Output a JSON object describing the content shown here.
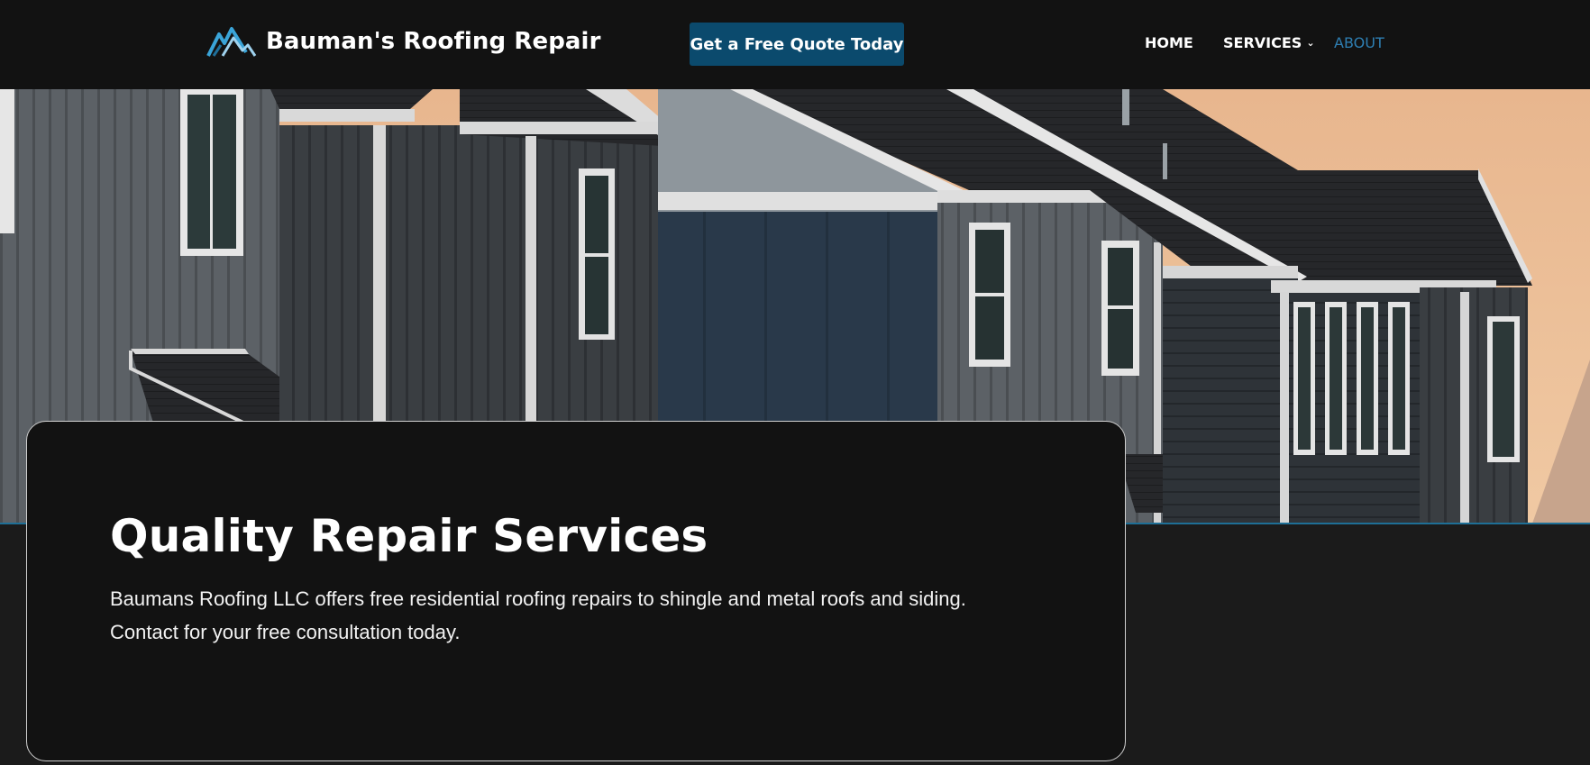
{
  "header": {
    "brand_name": "Bauman's Roofing Repair",
    "logo_icon": "mountain-roof-logo",
    "cta_label": "Get a Free Quote Today",
    "nav": {
      "home": "HOME",
      "services": "SERVICES",
      "services_icon": "chevron-down-icon",
      "about": "ABOUT"
    }
  },
  "hero": {
    "image": "row of gray vertical-siding houses with dark shingle roofs at dusk"
  },
  "card": {
    "title": "Quality Repair Services",
    "line1": "Baumans Roofing LLC offers free residential roofing repairs to shingle and metal roofs and siding.",
    "line2": "Contact for your free consultation today."
  },
  "colors": {
    "header_bg": "#121212",
    "page_bg": "#1b1b1b",
    "cta_bg": "#0b4a6d",
    "about_link": "#2e7fb3",
    "accent_line": "#1e6f96",
    "card_bg": "#121212",
    "card_border": "#cfcfcf"
  }
}
